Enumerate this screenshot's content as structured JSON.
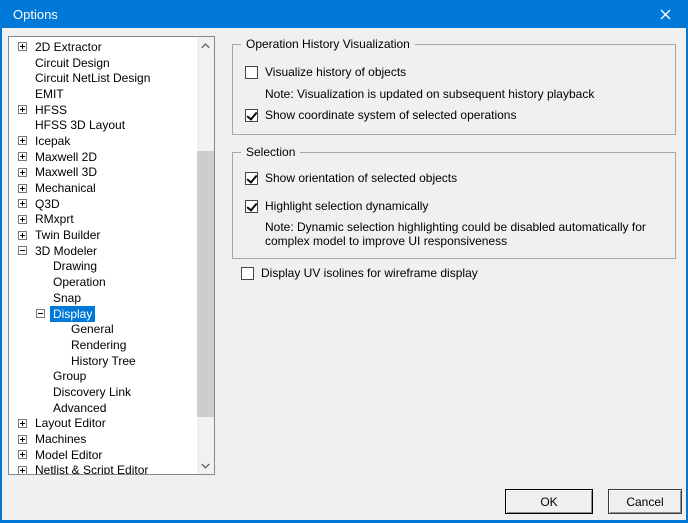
{
  "window": {
    "title": "Options"
  },
  "icons": {
    "close": "✕",
    "scroll_up": "∧",
    "scroll_down": "∨",
    "expand": "+",
    "collapse": "−",
    "check": "✓"
  },
  "colors": {
    "titlebar": "#0078D7",
    "dialog_bg": "#F0F0F0",
    "selection_bg": "#0078D7",
    "group_border": "#A7A7A7",
    "scrollbar_thumb": "#CDCDCD",
    "tree_border": "#828790"
  },
  "tree": {
    "items": [
      {
        "label": "2D Extractor",
        "expander": "plus",
        "state": ""
      },
      {
        "label": "Circuit Design",
        "expander": "none",
        "state": ""
      },
      {
        "label": "Circuit NetList Design",
        "expander": "none",
        "state": ""
      },
      {
        "label": "EMIT",
        "expander": "none",
        "state": ""
      },
      {
        "label": "HFSS",
        "expander": "plus",
        "state": ""
      },
      {
        "label": "HFSS 3D Layout",
        "expander": "none",
        "state": ""
      },
      {
        "label": "Icepak",
        "expander": "plus",
        "state": ""
      },
      {
        "label": "Maxwell 2D",
        "expander": "plus",
        "state": ""
      },
      {
        "label": "Maxwell 3D",
        "expander": "plus",
        "state": ""
      },
      {
        "label": "Mechanical",
        "expander": "plus",
        "state": ""
      },
      {
        "label": "Q3D",
        "expander": "plus",
        "state": ""
      },
      {
        "label": "RMxprt",
        "expander": "plus",
        "state": ""
      },
      {
        "label": "Twin Builder",
        "expander": "plus",
        "state": ""
      },
      {
        "label": "3D Modeler",
        "expander": "minus",
        "state": ""
      },
      {
        "label": "Drawing",
        "expander": "none",
        "state": ""
      },
      {
        "label": "Operation",
        "expander": "none",
        "state": ""
      },
      {
        "label": "Snap",
        "expander": "none",
        "state": ""
      },
      {
        "label": "Display",
        "expander": "minus",
        "state": "selected"
      },
      {
        "label": "General",
        "expander": "none",
        "state": ""
      },
      {
        "label": "Rendering",
        "expander": "none",
        "state": ""
      },
      {
        "label": "History Tree",
        "expander": "none",
        "state": ""
      },
      {
        "label": "Group",
        "expander": "none",
        "state": ""
      },
      {
        "label": "Discovery Link",
        "expander": "none",
        "state": ""
      },
      {
        "label": "Advanced",
        "expander": "none",
        "state": ""
      },
      {
        "label": "Layout Editor",
        "expander": "plus",
        "state": ""
      },
      {
        "label": "Machines",
        "expander": "plus",
        "state": ""
      },
      {
        "label": "Model Editor",
        "expander": "plus",
        "state": ""
      },
      {
        "label": "Netlist & Script Editor",
        "expander": "plus",
        "state": ""
      }
    ]
  },
  "panel": {
    "operation_history": {
      "title": "Operation History Visualization",
      "visualize_history": {
        "label": "Visualize history of objects",
        "state": "unchecked"
      },
      "note": "Note: Visualization is updated on subsequent history playback",
      "show_coordinate": {
        "label": "Show coordinate system of selected operations",
        "state": "checked"
      }
    },
    "selection": {
      "title": "Selection",
      "show_orientation": {
        "label": "Show orientation of selected objects",
        "state": "checked"
      },
      "highlight_selection": {
        "label": "Highlight selection dynamically",
        "state": "checked"
      },
      "note": "Note: Dynamic selection highlighting could be disabled automatically for complex model to improve UI responsiveness"
    },
    "display_uv": {
      "label": "Display UV isolines for wireframe display",
      "state": "unchecked"
    }
  },
  "buttons": {
    "ok": "OK",
    "cancel": "Cancel"
  }
}
